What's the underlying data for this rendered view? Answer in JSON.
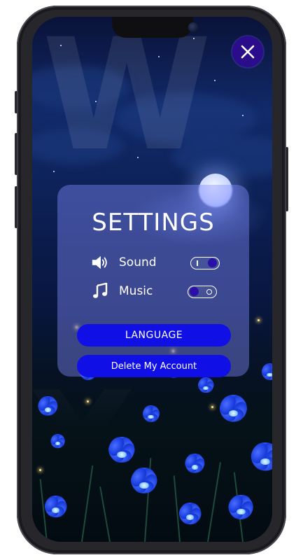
{
  "settings": {
    "title": "SETTINGS",
    "sound_label": "Sound",
    "sound_enabled": true,
    "music_label": "Music",
    "music_enabled": false,
    "language_button": "LANGUAGE",
    "delete_account_button": "Delete My Account"
  },
  "icons": {
    "close": "close-icon",
    "sound": "speaker-icon",
    "music": "music-note-icon"
  },
  "colors": {
    "panel_overlay": "#828cff",
    "button_primary": "#1010e6",
    "close_button": "#2b0d8c",
    "toggle_knob": "#2a0fa8"
  }
}
